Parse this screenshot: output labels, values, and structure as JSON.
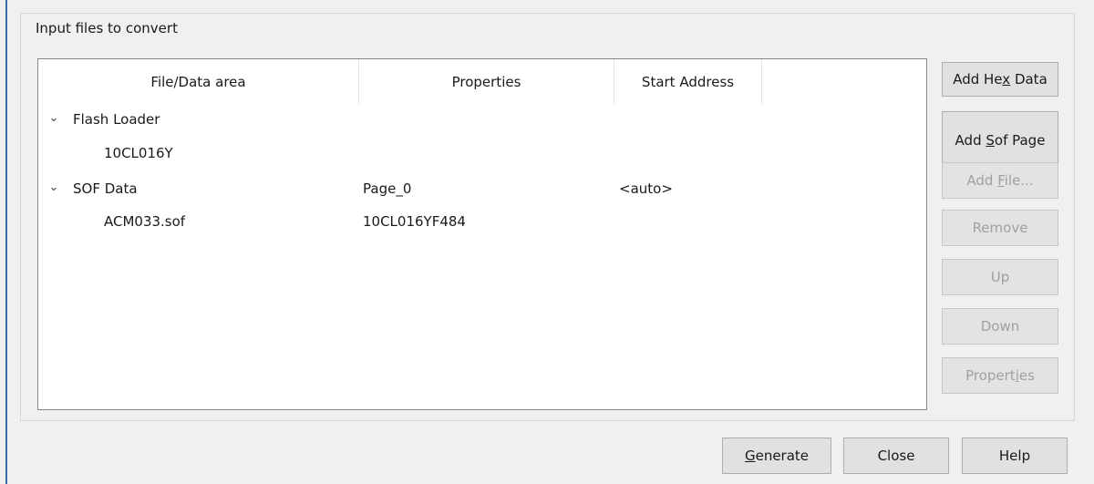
{
  "groupbox": {
    "title": "Input files to convert"
  },
  "listview": {
    "columns": [
      "File/Data area",
      "Properties",
      "Start Address"
    ],
    "rows": [
      {
        "expander": "⌄",
        "name": "Flash Loader",
        "properties": "",
        "start_address": ""
      },
      {
        "expander": "",
        "name": "10CL016Y",
        "properties": "",
        "start_address": ""
      },
      {
        "expander": "⌄",
        "name": "SOF Data",
        "properties": "Page_0",
        "start_address": "<auto>"
      },
      {
        "expander": "",
        "name": "ACM033.sof",
        "properties": "10CL016YF484",
        "start_address": ""
      }
    ]
  },
  "side_buttons": [
    {
      "label_pre": "Add He",
      "mnemonic": "x",
      "label_post": " Data",
      "enabled": true
    },
    {
      "label_pre": "Add ",
      "mnemonic": "S",
      "label_post": "of Page",
      "enabled": true
    },
    {
      "label_pre": "Add ",
      "mnemonic": "F",
      "label_post": "ile...",
      "enabled": false
    },
    {
      "label_pre": "Remove",
      "mnemonic": "",
      "label_post": "",
      "enabled": false
    },
    {
      "label_pre": "Up",
      "mnemonic": "",
      "label_post": "",
      "enabled": false
    },
    {
      "label_pre": "Down",
      "mnemonic": "",
      "label_post": "",
      "enabled": false
    },
    {
      "label_pre": "Propert",
      "mnemonic": "i",
      "label_post": "es",
      "enabled": false
    }
  ],
  "footer": {
    "generate": {
      "mnemonic": "G",
      "label_post": "enerate"
    },
    "close": "Close",
    "help": "Help"
  },
  "colors": {
    "window_edge": "#3c6da8",
    "button_face": "#e1e1e1",
    "disabled_text": "#a0a0a0"
  }
}
